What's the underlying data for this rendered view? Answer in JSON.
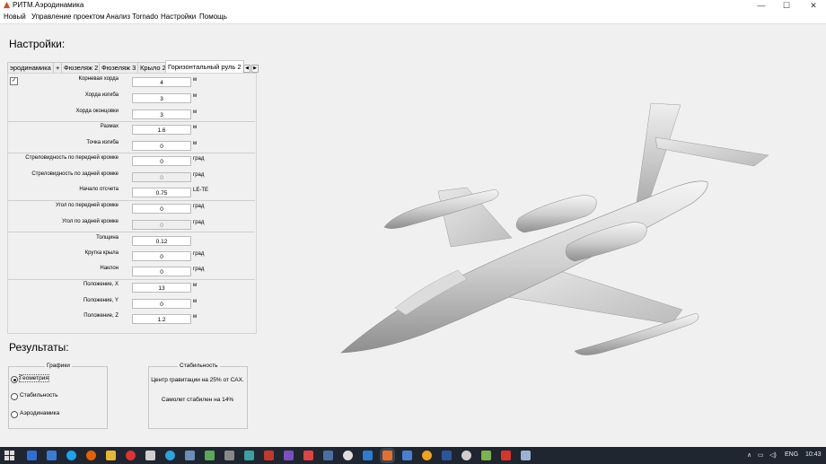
{
  "window": {
    "title": "РИТМ.Аэродинамика",
    "controls": [
      "—",
      "☐",
      "✕"
    ]
  },
  "menu": [
    "Новый",
    "Управление проектом",
    "Анализ Tornado",
    "Настройки",
    "Помощь"
  ],
  "settings": {
    "title": "Настройки:",
    "tabs": [
      "эродинамика",
      "+",
      "Фюзеляж 2",
      "Фюзеляж 3",
      "Крыло 2",
      "Горизонтальный руль 2"
    ],
    "active_tab": "Горизонтальный руль 2",
    "checkbox_checked": true,
    "params": [
      {
        "label": "Корневая хорда",
        "value": "4",
        "unit": "м"
      },
      {
        "label": "Хорда изгиба",
        "value": "3",
        "unit": "м"
      },
      {
        "label": "Хорда оконцовки",
        "value": "3",
        "unit": "м"
      },
      {
        "label": "Размах",
        "value": "1.6",
        "unit": "м"
      },
      {
        "label": "Точка изгиба",
        "value": "0",
        "unit": "м"
      },
      {
        "label": "Стреловидность по передней кромке",
        "value": "0",
        "unit": "град"
      },
      {
        "label": "Стреловидность по задней кромке",
        "value": "0",
        "unit": "град",
        "disabled": true
      },
      {
        "label": "Начало отсчета",
        "value": "0.75",
        "unit": "LE-TE"
      },
      {
        "label": "Угол по передней кромке",
        "value": "0",
        "unit": "град"
      },
      {
        "label": "Угол по задней кромке",
        "value": "0",
        "unit": "град",
        "disabled": true
      },
      {
        "label": "Толщина",
        "value": "0.12",
        "unit": ""
      },
      {
        "label": "Крутка крыла",
        "value": "0",
        "unit": "град"
      },
      {
        "label": "Наклон",
        "value": "0",
        "unit": "град"
      },
      {
        "label": "Положение, X",
        "value": "13",
        "unit": "м"
      },
      {
        "label": "Положение, Y",
        "value": "0",
        "unit": "м"
      },
      {
        "label": "Положение, Z",
        "value": "1.2",
        "unit": "м"
      }
    ]
  },
  "results": {
    "title": "Результаты:",
    "graphs": {
      "title": "Графики",
      "options": [
        "Геометрия",
        "Стабильность",
        "Аэродинамика"
      ],
      "selected": 0
    },
    "stability": {
      "title": "Стабильность",
      "cg_text": "Центр гравитации на 25% от САХ.",
      "stable_text": "Самолет стабилен на 14%"
    }
  },
  "taskbar": {
    "apps": [
      "start",
      "outlook",
      "folder",
      "skype",
      "firefox",
      "explorer",
      "vivaldi",
      "app",
      "telegram",
      "app",
      "app",
      "app",
      "app",
      "app",
      "visual-studio",
      "app",
      "app",
      "app",
      "vscode",
      "java",
      "app",
      "app",
      "word",
      "settings",
      "app",
      "pdf",
      "app"
    ],
    "tray": {
      "language": "ENG",
      "time": "10:43"
    }
  }
}
